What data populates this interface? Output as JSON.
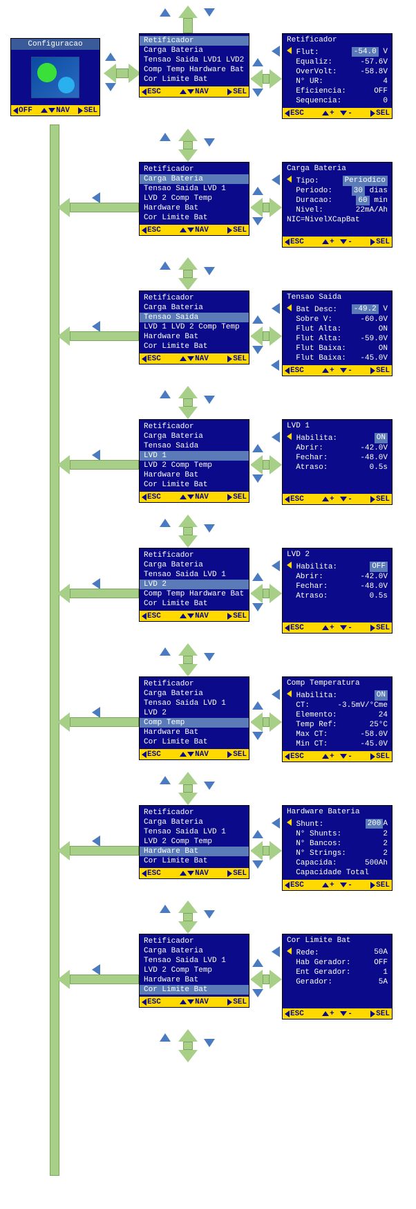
{
  "config": {
    "title": "Configuracao"
  },
  "footers": {
    "config": {
      "off": "OFF",
      "nav": "NAV",
      "sel": "SEL"
    },
    "menu": {
      "esc": "ESC",
      "nav": "NAV",
      "sel": "SEL"
    },
    "detail": {
      "esc": "ESC",
      "plus": "+",
      "minus": "-",
      "sel": "SEL"
    }
  },
  "menu_items": {
    "retificador": "Retificador",
    "carga_bateria": "Carga Bateria",
    "tensao_saida": "Tensao Saida",
    "lvd1": "LVD1",
    "lvd1_sp": "LVD 1",
    "lvd2": "LVD2",
    "lvd2_sp": "LVD 2",
    "comp_temp": "Comp Temp",
    "hardware_bat": "Hardware Bat",
    "cor_limite_bat": "Cor Limite Bat"
  },
  "detail": {
    "retificador": {
      "title": "Retificador",
      "flut_l": "Flut:",
      "flut_v": "-54.0",
      "flut_u": "V",
      "equaliz_l": "Equaliz:",
      "equaliz_v": "-57.6V",
      "overvolt_l": "OverVolt:",
      "overvolt_v": "-58.8V",
      "nur_l": "N° UR:",
      "nur_v": "4",
      "efic_l": "Eficiencia:",
      "efic_v": "OFF",
      "seq_l": "Sequencia:",
      "seq_v": "0"
    },
    "carga": {
      "title": "Carga Bateria",
      "tipo_l": "Tipo:",
      "tipo_v": "Periodico",
      "periodo_l": "Periodo:",
      "periodo_v": "30",
      "periodo_u": "dias",
      "duracao_l": "Duracao:",
      "duracao_v": "60",
      "duracao_u": "min",
      "nivel_l": "Nivel:",
      "nivel_v": "22mA/Ah",
      "nic": "NIC=NivelXCapBat"
    },
    "tensao": {
      "title": "Tensao Saida",
      "batdesc_l": "Bat Desc:",
      "batdesc_v": "-49.2",
      "batdesc_u": "V",
      "sobrev_l": "Sobre V:",
      "sobrev_v": "-60.0V",
      "flutalta_l": "Flut Alta:",
      "flutalta_v": "ON",
      "flutalta2_l": "Flut Alta:",
      "flutalta2_v": "-59.0V",
      "flutbaixa_l": "Flut Baixa:",
      "flutbaixa_v": "ON",
      "flutbaixa2_l": "Flut Baixa:",
      "flutbaixa2_v": "-45.0V"
    },
    "lvd1": {
      "title": "LVD 1",
      "hab_l": "Habilita:",
      "hab_v": "ON",
      "abrir_l": "Abrir:",
      "abrir_v": "-42.0V",
      "fechar_l": "Fechar:",
      "fechar_v": "-48.0V",
      "atraso_l": "Atraso:",
      "atraso_v": "0.5s"
    },
    "lvd2": {
      "title": "LVD 2",
      "hab_l": "Habilita:",
      "hab_v": "OFF",
      "abrir_l": "Abrir:",
      "abrir_v": "-42.0V",
      "fechar_l": "Fechar:",
      "fechar_v": "-48.0V",
      "atraso_l": "Atraso:",
      "atraso_v": "0.5s"
    },
    "comp_temp": {
      "title": "Comp Temperatura",
      "hab_l": "Habilita:",
      "hab_v": "ON",
      "ct_l": "CT:",
      "ct_v": "-3.5mV/°Cme",
      "elem_l": "Elemento:",
      "elem_v": "24",
      "tref_l": "Temp Ref:",
      "tref_v": "25°C",
      "maxct_l": "Max CT:",
      "maxct_v": "-58.0V",
      "minct_l": "Min CT:",
      "minct_v": "-45.0V"
    },
    "hwbat": {
      "title": "Hardware Bateria",
      "shunt_l": "Shunt:",
      "shunt_v": "200",
      "shunt_u": "A",
      "nshunt_l": "N° Shunts:",
      "nshunt_v": "2",
      "nbanco_l": "N° Bancos:",
      "nbanco_v": "2",
      "nstring_l": "N° Strings:",
      "nstring_v": "2",
      "cap_l": "Capacida:",
      "cap_v": "500Ah",
      "captot": "Capacidade Total"
    },
    "corlim": {
      "title": "Cor Limite Bat",
      "rede_l": "Rede:",
      "rede_v": "50A",
      "habger_l": "Hab Gerador:",
      "habger_v": "OFF",
      "entger_l": "Ent Gerador:",
      "entger_v": "1",
      "ger_l": "Gerador:",
      "ger_v": "5A"
    }
  }
}
